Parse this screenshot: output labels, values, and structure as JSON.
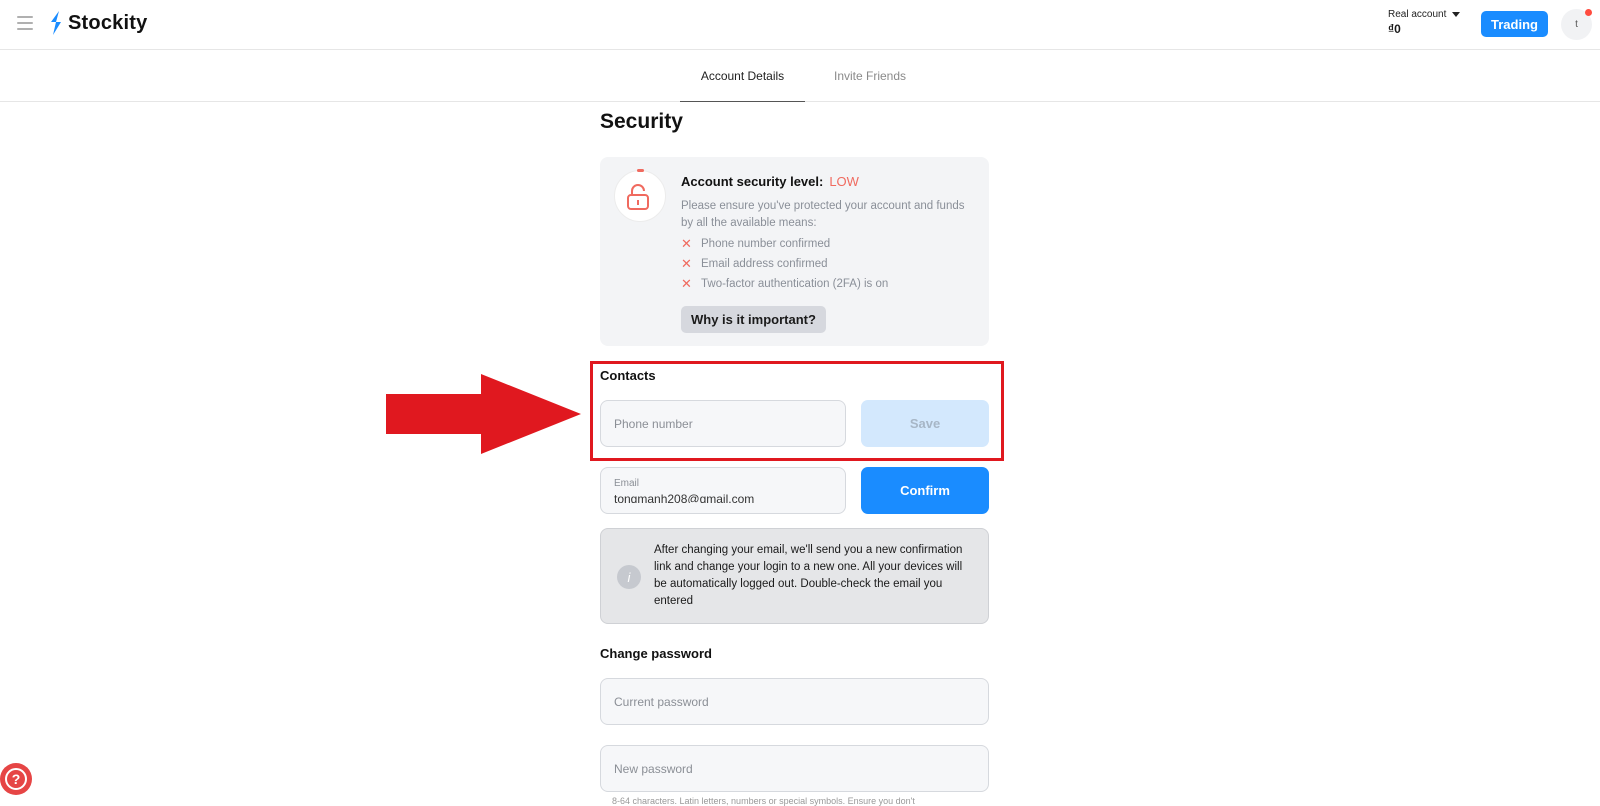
{
  "header": {
    "brand": "Stockity",
    "account_label": "Real account",
    "account_balance": "₫0",
    "trading_label": "Trading",
    "avatar_letter": "t"
  },
  "tabs": [
    {
      "label": "Account Details",
      "active": true
    },
    {
      "label": "Invite Friends",
      "active": false
    }
  ],
  "page_title": "Security",
  "security_card": {
    "title": "Account security level:",
    "level": "LOW",
    "description": "Please ensure you've protected your account and funds by all the available means:",
    "items": [
      "Phone number confirmed",
      "Email address confirmed",
      "Two-factor authentication (2FA) is on"
    ],
    "why_button": "Why is it important?"
  },
  "contacts": {
    "label": "Contacts",
    "phone_placeholder": "Phone number",
    "save_label": "Save",
    "email_label": "Email",
    "email_value": "tongmanh208@gmail.com",
    "confirm_label": "Confirm"
  },
  "info_box": {
    "text": "After changing your email, we'll send you a new confirmation link and change your login to a new one. All your devices will be automatically logged out. Double-check the email you entered"
  },
  "change_password": {
    "label": "Change password",
    "current_placeholder": "Current password",
    "new_placeholder": "New password",
    "hint": "8-64 characters. Latin letters, numbers or special symbols. Ensure you don't"
  },
  "colors": {
    "accent": "#1a8cff",
    "danger": "#f06a5f",
    "annotation": "#e0181f"
  }
}
